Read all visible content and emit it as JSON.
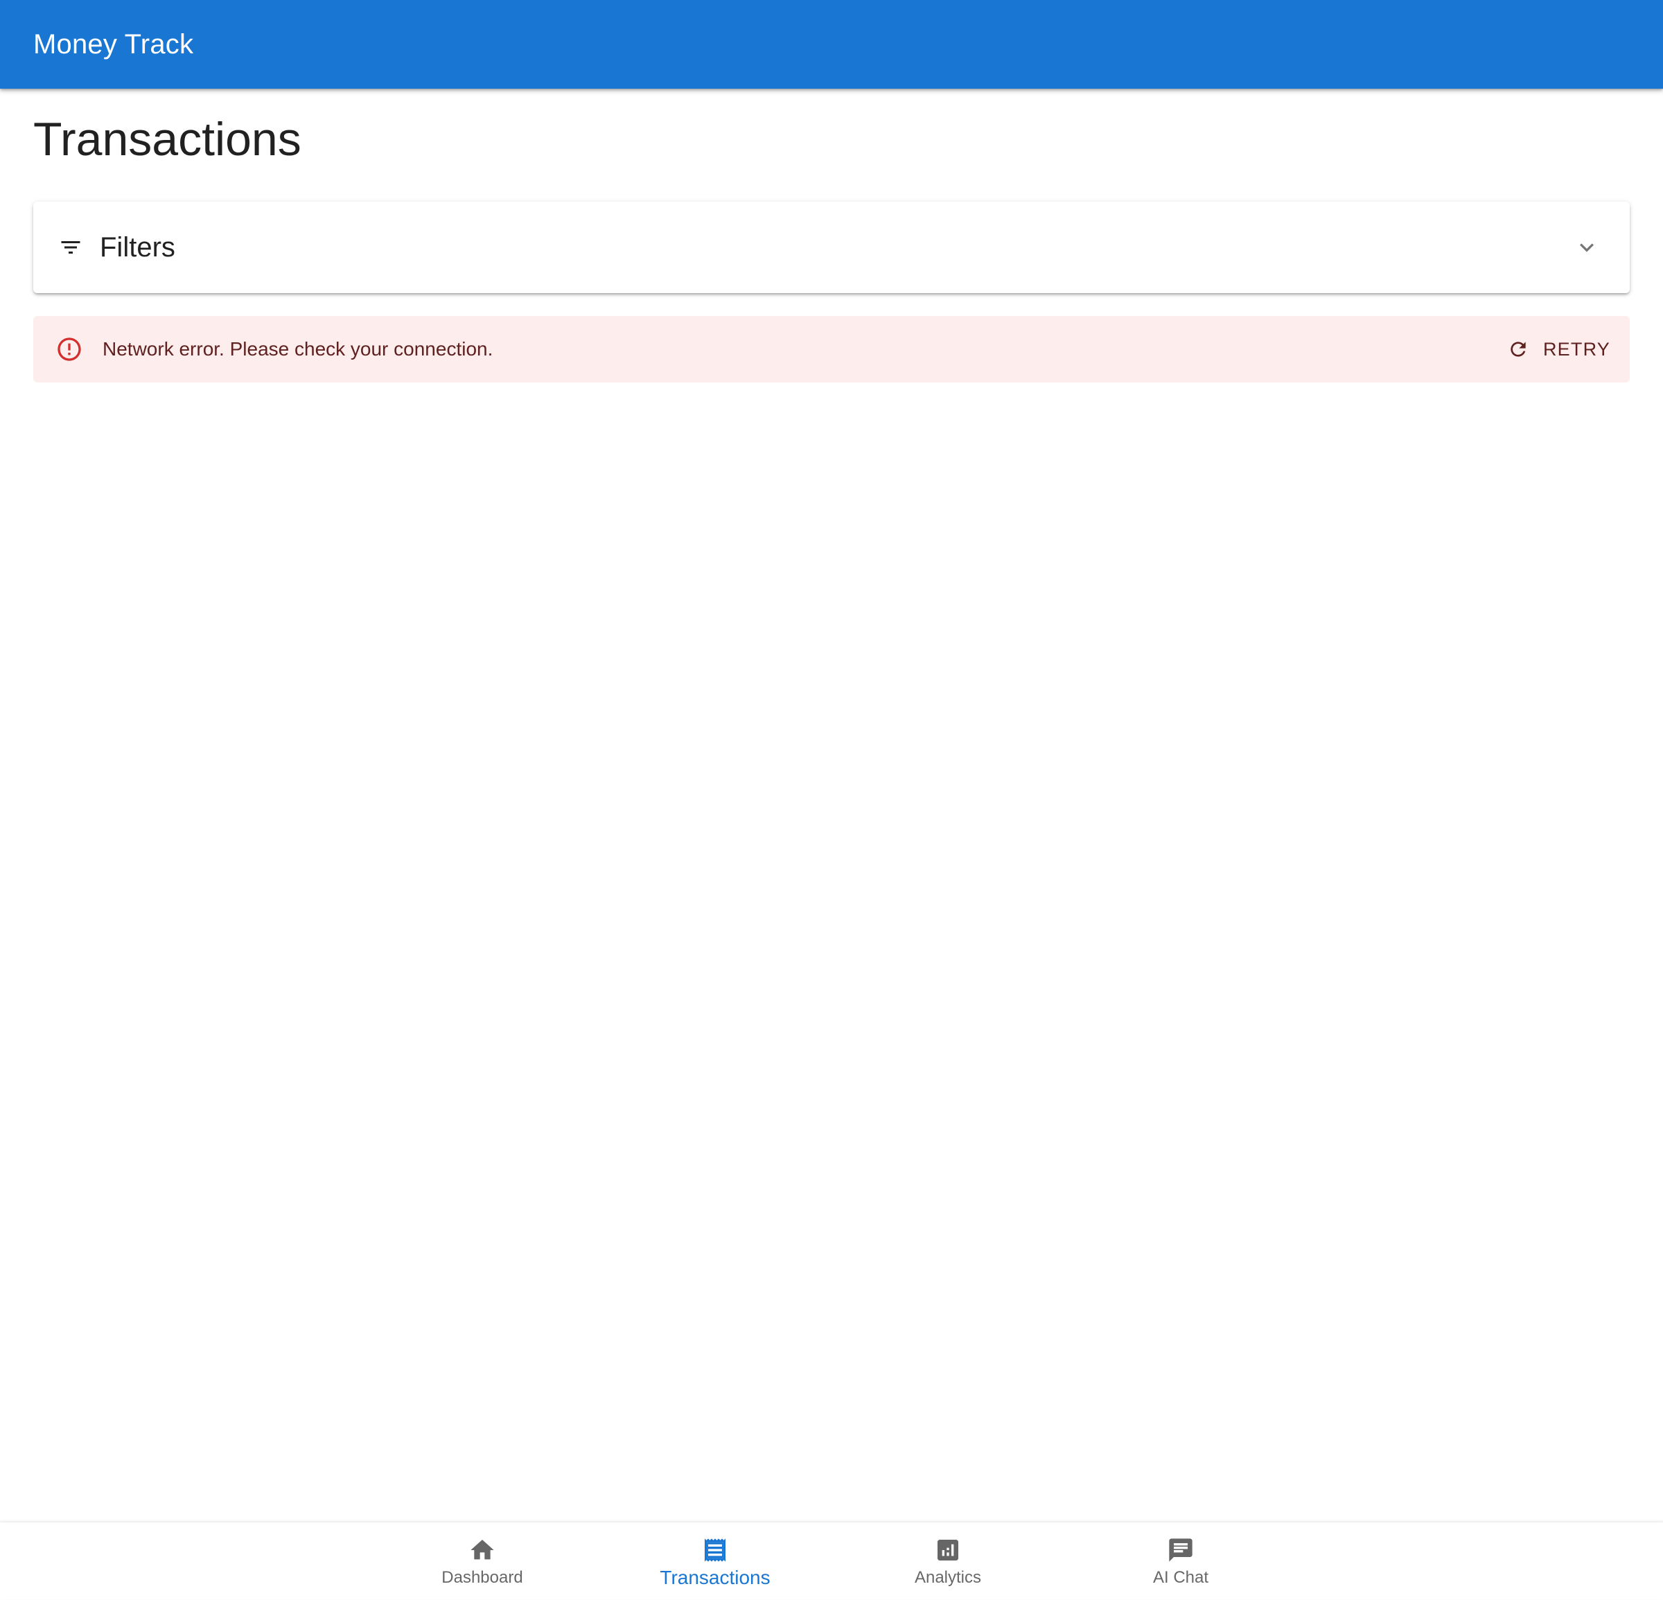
{
  "app": {
    "title": "Money Track",
    "accent_color": "#1976d2"
  },
  "page": {
    "title": "Transactions"
  },
  "filters": {
    "label": "Filters",
    "icon": "filter-list-icon",
    "expand_icon": "chevron-down-icon",
    "expanded": false
  },
  "alert": {
    "severity": "error",
    "icon": "error-outline-icon",
    "message": "Network error. Please check your connection.",
    "action_label": "RETRY",
    "action_icon": "refresh-icon",
    "background_color": "#fdeded",
    "text_color": "#5f2120",
    "icon_color": "#d32f2f"
  },
  "bottom_nav": {
    "active": "Transactions",
    "items": [
      {
        "label": "Dashboard",
        "icon": "home-icon"
      },
      {
        "label": "Transactions",
        "icon": "receipt-icon"
      },
      {
        "label": "Analytics",
        "icon": "analytics-icon"
      },
      {
        "label": "AI Chat",
        "icon": "chat-icon"
      }
    ]
  }
}
